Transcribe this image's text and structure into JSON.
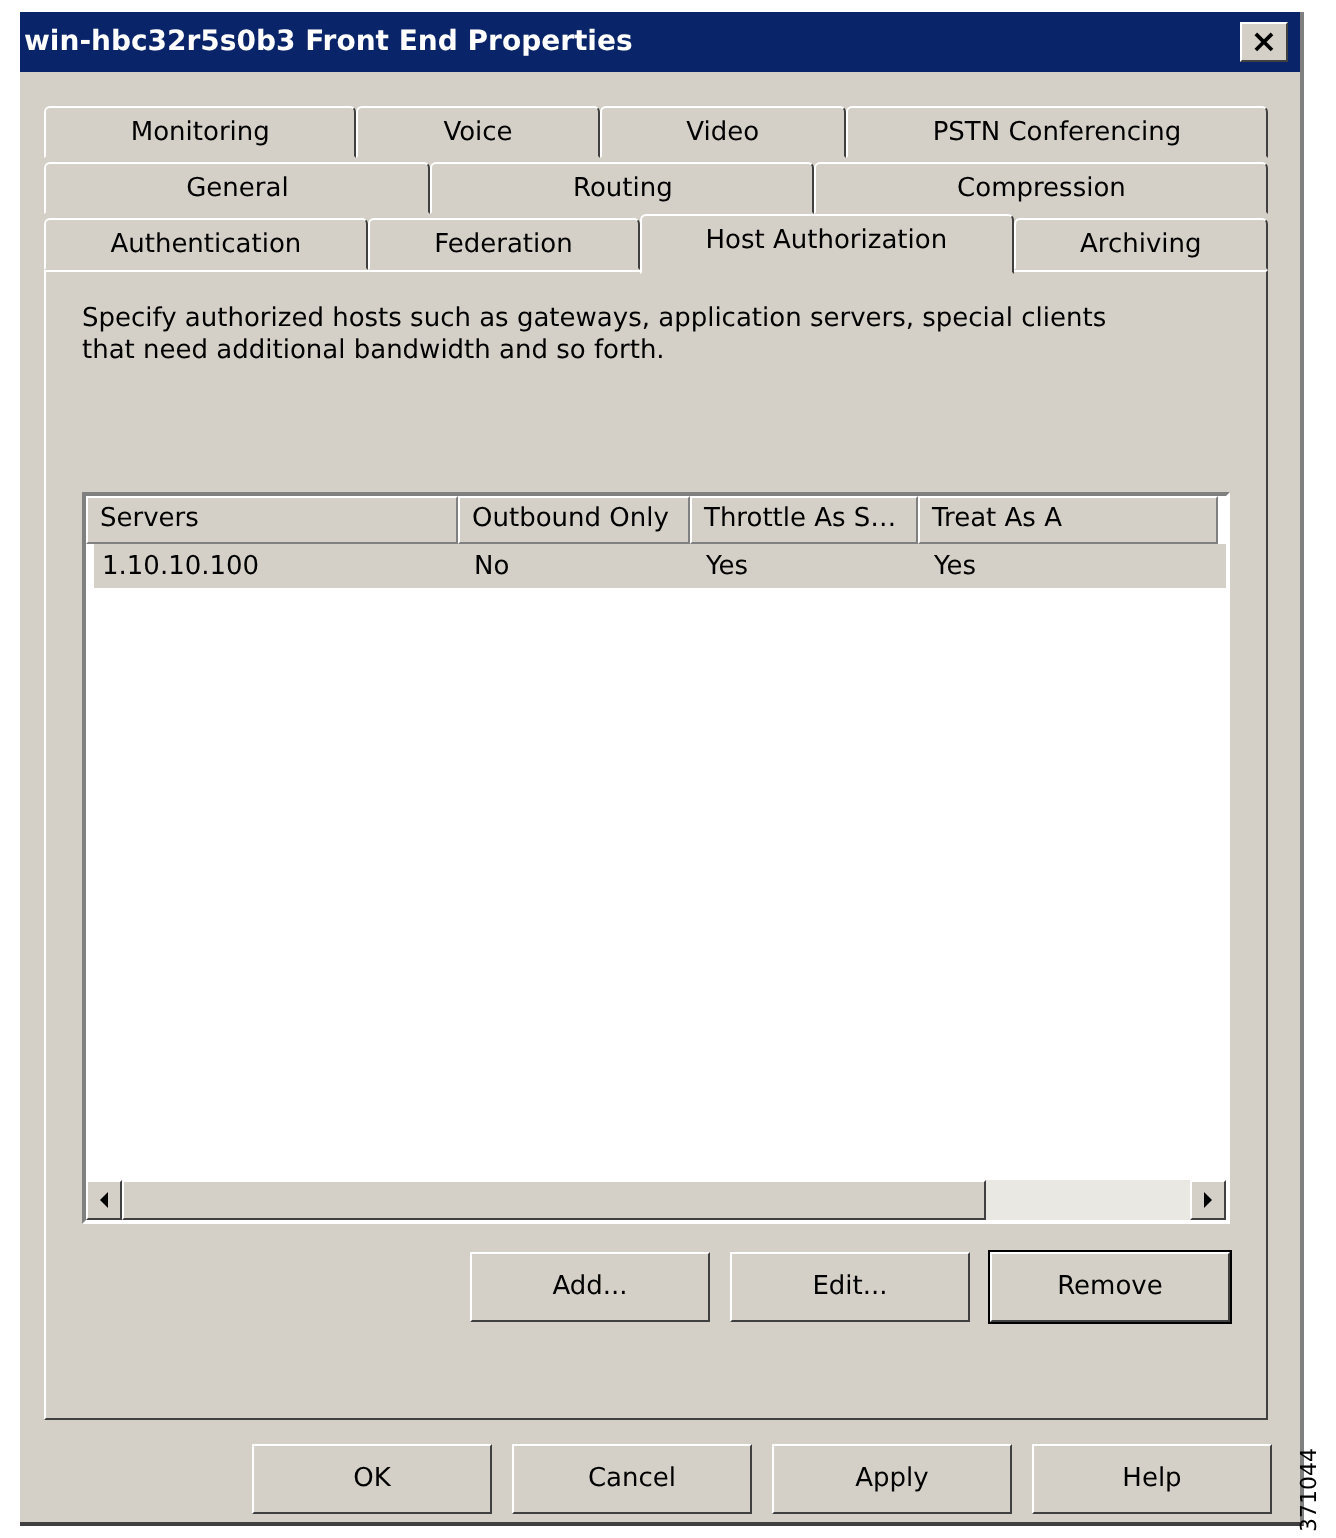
{
  "window": {
    "title": "win-hbc32r5s0b3 Front End Properties",
    "close": "×"
  },
  "tab_rows": [
    [
      {
        "label": "Monitoring",
        "selected": false
      },
      {
        "label": "Voice",
        "selected": false
      },
      {
        "label": "Video",
        "selected": false
      },
      {
        "label": "PSTN Conferencing",
        "selected": false
      }
    ],
    [
      {
        "label": "General",
        "selected": false
      },
      {
        "label": "Routing",
        "selected": false
      },
      {
        "label": "Compression",
        "selected": false
      }
    ],
    [
      {
        "label": "Authentication",
        "selected": false
      },
      {
        "label": "Federation",
        "selected": false
      },
      {
        "label": "Host Authorization",
        "selected": true
      },
      {
        "label": "Archiving",
        "selected": false
      }
    ]
  ],
  "description": "Specify authorized hosts such as gateways, application servers, special clients that need additional bandwidth and so forth.",
  "table": {
    "columns": [
      "Servers",
      "Outbound Only",
      "Throttle As S…",
      "Treat As A"
    ],
    "rows": [
      {
        "cells": [
          "1.10.10.100",
          "No",
          "Yes",
          "Yes"
        ],
        "selected": true
      }
    ]
  },
  "list_buttons": [
    {
      "label": "Add...",
      "default": false
    },
    {
      "label": "Edit...",
      "default": false
    },
    {
      "label": "Remove",
      "default": true
    }
  ],
  "dialog_buttons": [
    "OK",
    "Cancel",
    "Apply",
    "Help"
  ],
  "figure_number": "371044"
}
